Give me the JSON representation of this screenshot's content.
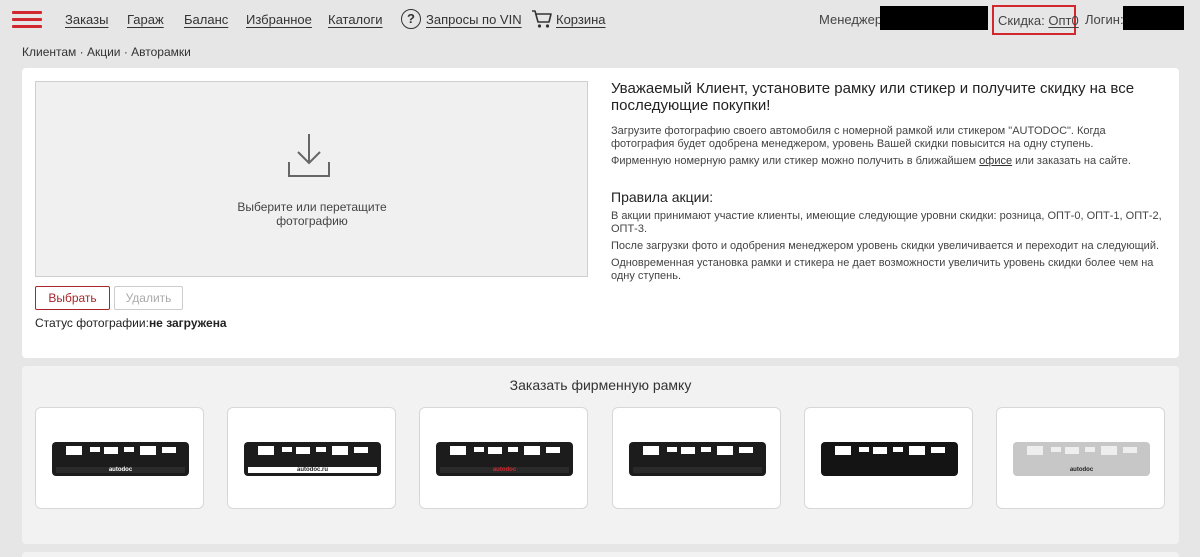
{
  "nav": {
    "links": [
      "Заказы",
      "Гараж",
      "Баланс",
      "Избранное",
      "Каталоги",
      "Запросы по VIN",
      "Корзина"
    ],
    "vin_icon": "question-circle-icon",
    "cart_icon": "cart-icon",
    "manager_label": "Менеджер:",
    "discount_label": "Скидка:",
    "discount_value": "Опт0",
    "login_label": "Логин:"
  },
  "breadcrumb": "Клиентам · Акции · Авторамки",
  "upload": {
    "icon": "download-icon",
    "text_line1": "Выберите или перетащите",
    "text_line2": "фотографию",
    "select_button": "Выбрать",
    "delete_button": "Удалить",
    "status_label": "Статус фотографии:",
    "status_value": "не загружена"
  },
  "info": {
    "heading": "Уважаемый Клиент, установите рамку или стикер и получите скидку на все последующие покупки!",
    "p1": "Загрузите фотографию своего автомобиля с номерной рамкой или стикером \"AUTODOC\". Когда фотография будет одобрена менеджером, уровень Вашей скидки повысится на одну ступень.",
    "p2_before": "Фирменную номерную рамку или стикер можно получить в ближайшем ",
    "p2_link": "офисе",
    "p2_after": " или заказать на сайте.",
    "rules_heading": "Правила акции:",
    "r1": "В акции принимают участие клиенты, имеющие следующие уровни скидки: розница, ОПТ-0, ОПТ-1, ОПТ-2, ОПТ-3.",
    "r2": "После загрузки фото и одобрения менеджером уровень скидки увеличивается и переходит на следующий.",
    "r3": "Одновременная установка рамки и стикера не дает возможности увеличить уровень скидки более чем на одну ступень."
  },
  "frames": {
    "title": "Заказать фирменную рамку",
    "items": [
      {
        "color": "#1c1c1c",
        "strip": "#2a2a2a",
        "brand": "autodoc",
        "brand_color": "#ffffff"
      },
      {
        "color": "#1c1c1c",
        "strip": "#ffffff",
        "brand": "autodoc.ru",
        "brand_color": "#222222"
      },
      {
        "color": "#1c1c1c",
        "strip": "#2a2a2a",
        "brand": "autodoc",
        "brand_color": "#d0282e"
      },
      {
        "color": "#1c1c1c",
        "strip": "#2a2a2a",
        "brand": "",
        "brand_color": "#888888"
      },
      {
        "color": "#141414",
        "strip": "#141414",
        "brand": "",
        "brand_color": "#c9a94a"
      },
      {
        "color": "#c7c7c7",
        "strip": "#c7c7c7",
        "brand": "autodoc",
        "brand_color": "#222222"
      }
    ]
  }
}
